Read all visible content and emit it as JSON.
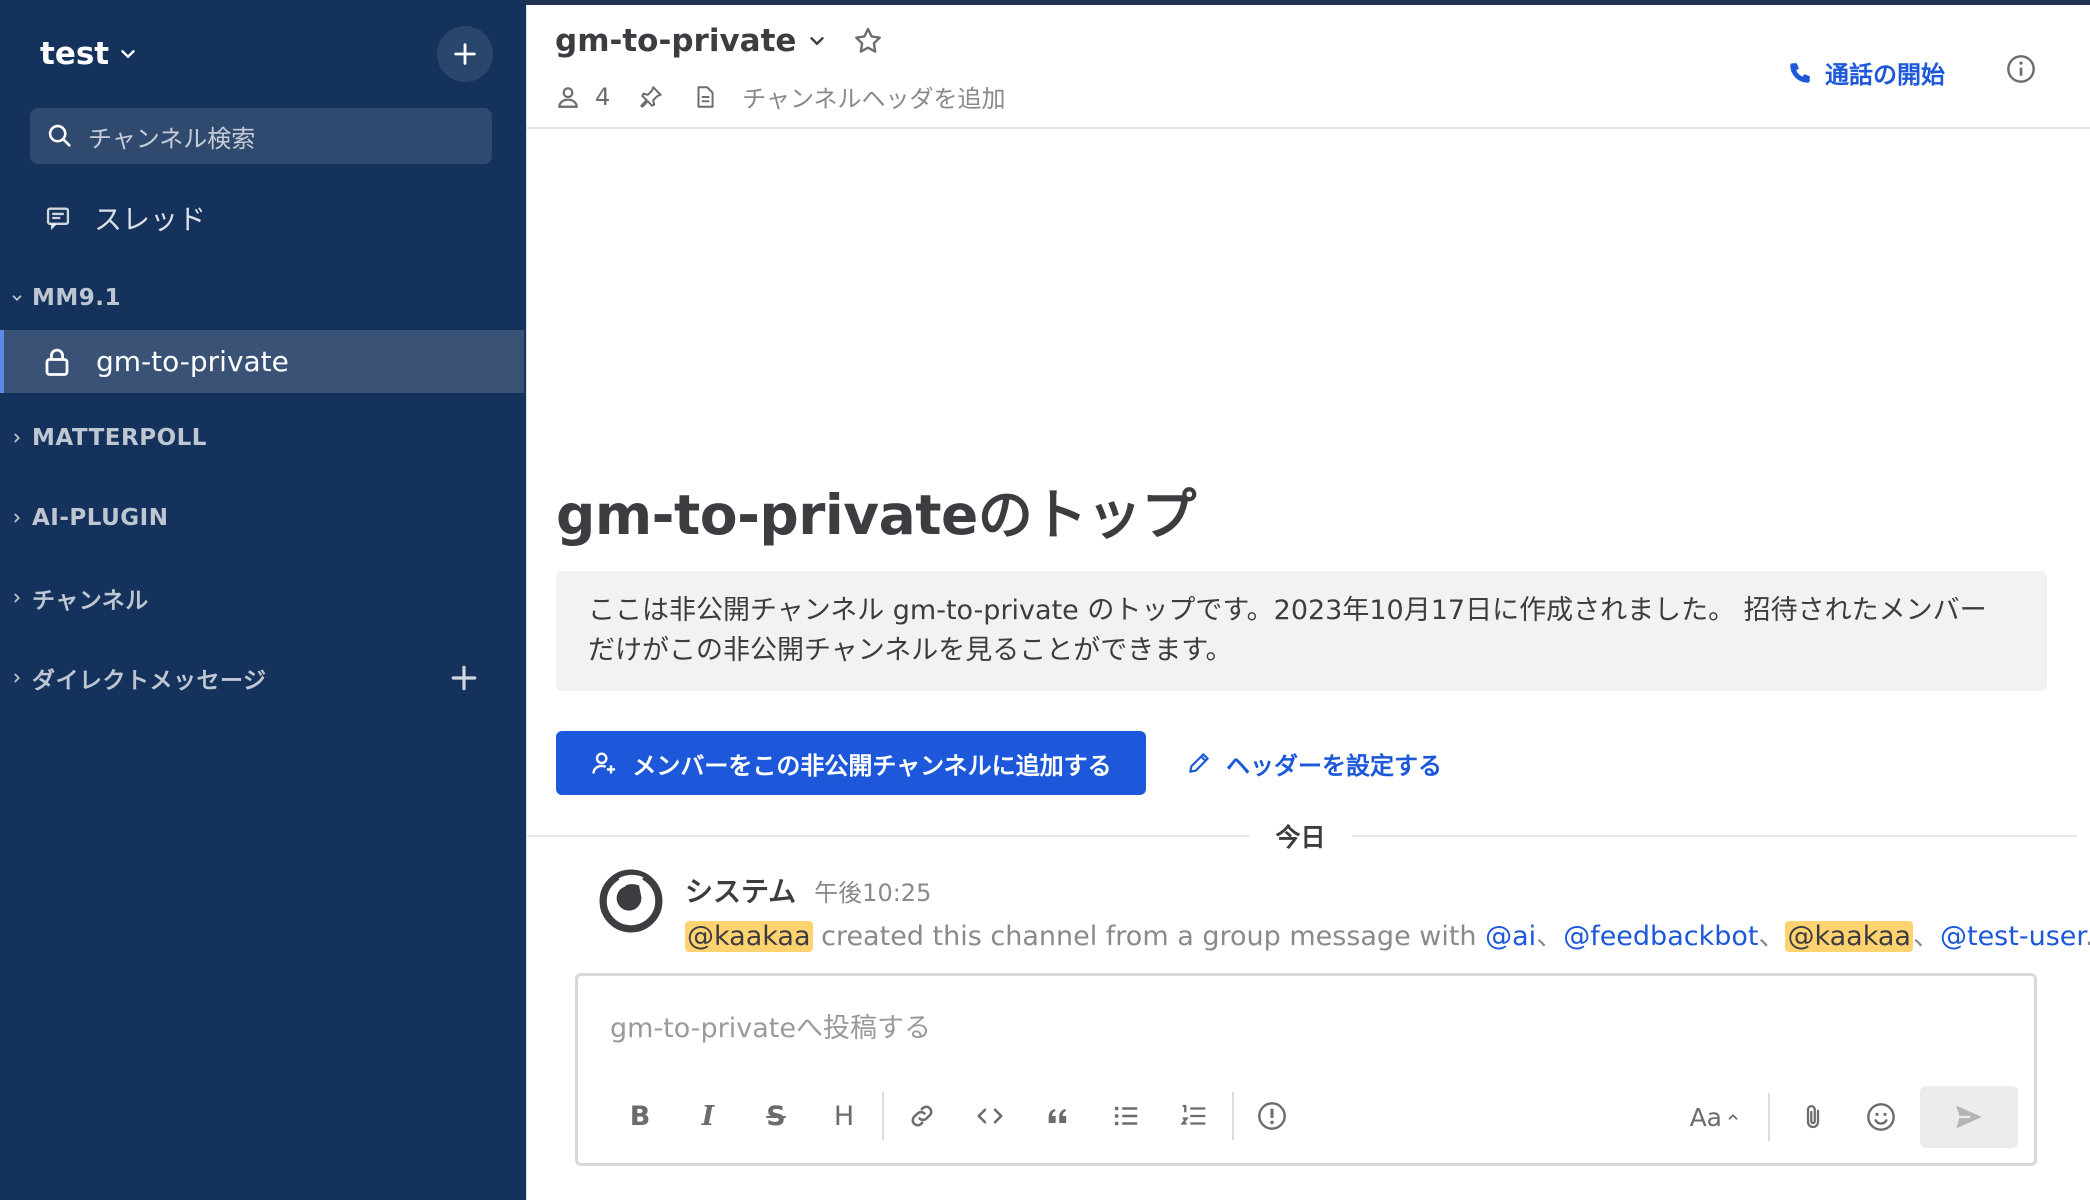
{
  "sidebar": {
    "team_name": "test",
    "search_placeholder": "チャンネル検索",
    "threads_label": "スレッド",
    "categories": [
      {
        "label": "MM9.1"
      },
      {
        "label": "MATTERPOLL"
      },
      {
        "label": "AI-PLUGIN"
      },
      {
        "label": "チャンネル"
      },
      {
        "label": "ダイレクトメッセージ"
      }
    ],
    "active_channel": "gm-to-private"
  },
  "header": {
    "channel_name": "gm-to-private",
    "member_count": "4",
    "header_placeholder": "チャンネルヘッダを追加",
    "call_label": "通話の開始"
  },
  "intro": {
    "title": "gm-to-privateのトップ",
    "description_line1": "ここは非公開チャンネル gm-to-private のトップです。2023年10月17日に作成されました。 招待されたメンバー",
    "description_line2": "だけがこの非公開チャンネルを見ることができます。",
    "add_members_label": "メンバーをこの非公開チャンネルに追加する",
    "set_header_label": "ヘッダーを設定する"
  },
  "date_separator": "今日",
  "post": {
    "author": "システム",
    "time": "午後10:25",
    "mention_creator": "@kaakaa",
    "text_middle": " created this channel from a group message with ",
    "mention_ai": "@ai",
    "sep1": "、",
    "mention_feedbackbot": "@feedbackbot",
    "sep2": "、",
    "mention_kaakaa": "@kaakaa",
    "sep3": "、",
    "mention_test_user": "@test-user",
    "end": "."
  },
  "composer": {
    "placeholder": "gm-to-privateへ投稿する",
    "format_bold": "B",
    "format_italic": "I",
    "format_strike": "S",
    "format_heading": "H",
    "font_toggle": "Aa"
  },
  "colors": {
    "sidebar_bg": "#14325c",
    "accent": "#1c58d9",
    "mention_highlight": "#ffd470"
  }
}
